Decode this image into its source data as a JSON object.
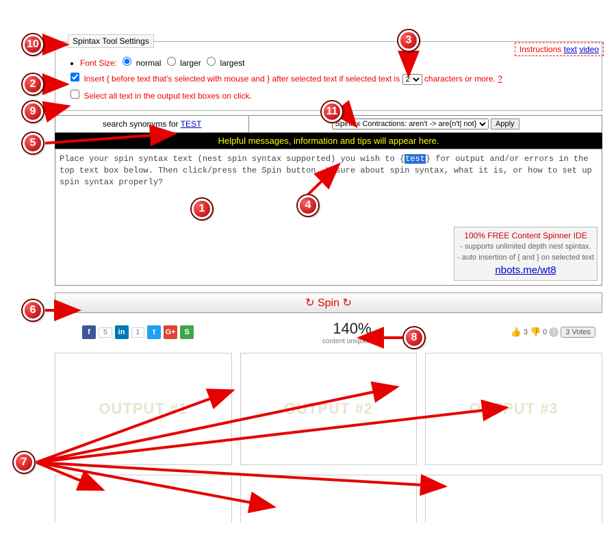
{
  "settings": {
    "legend": "Spintax Tool Settings",
    "fontSizeLabel": "Font Size:",
    "fontOptions": {
      "normal": "normal",
      "larger": "larger",
      "largest": "largest"
    },
    "insertText1": "Insert { before text that's selected with mouse and } after selected text if selected text is",
    "insertCount": "2",
    "insertText2": "characters or more.",
    "help": "?",
    "selectAllText": "Select all text in the output text boxes on click."
  },
  "instructions": {
    "label": "Instructions",
    "text": "text",
    "video": "video"
  },
  "toolbar": {
    "searchLabel1": "search synonyms for",
    "searchWord": "TEST",
    "contractionOption": "Spintax Contractions: aren't -> are{n't| not}",
    "apply": "Apply"
  },
  "tips": "Helpful messages, information and tips will appear here.",
  "input": {
    "pre": "Place your spin syntax text (nest spin syntax supported) you wish to {",
    "hl": "test",
    "post": "} for output and/or errors in the top text box below. Then click/press the Spin button. Unsure about spin syntax, what it is, or how to set up spin syntax properly?"
  },
  "promo": {
    "t": "100% FREE Content Spinner IDE",
    "l1": "- supports unlimited depth nest spintax.",
    "l2": "- auto insertion of { and } on selected text",
    "link": "nbots.me/wt8"
  },
  "spin": "↻ Spin ↻",
  "share": {
    "fb": "f",
    "fbCount": "5",
    "in": "in",
    "inCount": "1",
    "tw": "t",
    "gp": "G+",
    "st": "S"
  },
  "uniq": {
    "pct": "140%",
    "label": "content uniqueness"
  },
  "votes": {
    "up": "3",
    "down": "0",
    "btn": "3 Votes"
  },
  "outputs": {
    "o1": "OUTPUT #1",
    "o2": "OUTPUT #2",
    "o3": "OUTPUT #3"
  },
  "badges": [
    "1",
    "2",
    "3",
    "4",
    "5",
    "6",
    "7",
    "8",
    "9",
    "10",
    "11"
  ]
}
